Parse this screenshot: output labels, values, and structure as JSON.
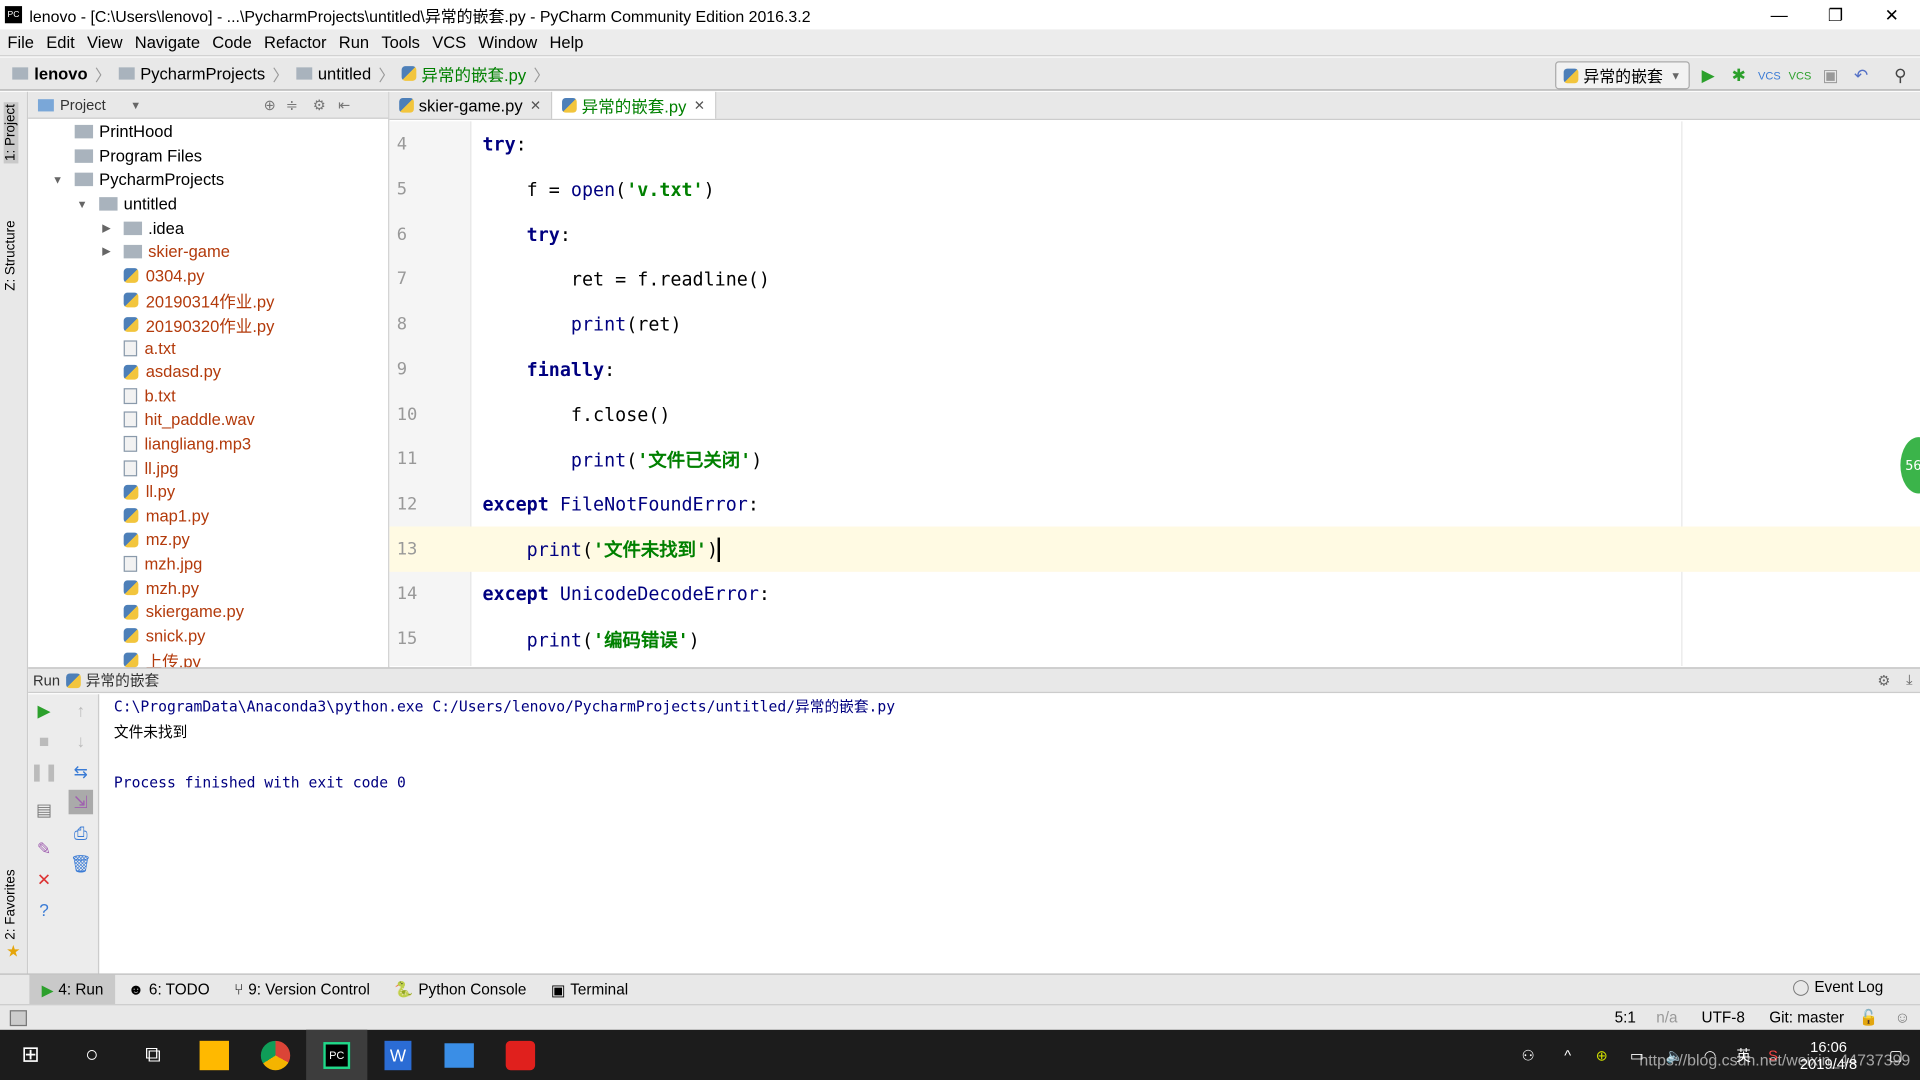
{
  "window": {
    "title": "lenovo - [C:\\Users\\lenovo] - ...\\PycharmProjects\\untitled\\异常的嵌套.py - PyCharm Community Edition 2016.3.2",
    "app_icon": "PC"
  },
  "menu": [
    "File",
    "Edit",
    "View",
    "Navigate",
    "Code",
    "Refactor",
    "Run",
    "Tools",
    "VCS",
    "Window",
    "Help"
  ],
  "breadcrumb": [
    "lenovo",
    "PycharmProjects",
    "untitled",
    "异常的嵌套.py"
  ],
  "run_config": "异常的嵌套",
  "toolbar_icons": [
    "run-icon",
    "debug-icon",
    "vcs-update-icon",
    "vcs-commit-icon",
    "history-icon",
    "revert-icon",
    "search-icon"
  ],
  "side_tabs": {
    "project": "1: Project",
    "structure": "Z: Structure",
    "favorites": "2: Favorites"
  },
  "project": {
    "header": "Project",
    "tree": [
      {
        "name": "PrintHood",
        "type": "folder",
        "depth": 1,
        "color": "#000"
      },
      {
        "name": "Program Files",
        "type": "folder",
        "depth": 1,
        "color": "#000"
      },
      {
        "name": "PycharmProjects",
        "type": "folder",
        "depth": 1,
        "expanded": true,
        "color": "#000"
      },
      {
        "name": "untitled",
        "type": "folder",
        "depth": 2,
        "expanded": true,
        "color": "#000"
      },
      {
        "name": ".idea",
        "type": "folder",
        "depth": 3,
        "collapsed": true,
        "color": "#000"
      },
      {
        "name": "skier-game",
        "type": "folder",
        "depth": 3,
        "collapsed": true,
        "color": "#b33a0b"
      },
      {
        "name": "0304.py",
        "type": "py",
        "depth": 3,
        "color": "#b33a0b"
      },
      {
        "name": "20190314作业.py",
        "type": "py",
        "depth": 3,
        "color": "#b33a0b"
      },
      {
        "name": "20190320作业.py",
        "type": "py",
        "depth": 3,
        "color": "#b33a0b"
      },
      {
        "name": "a.txt",
        "type": "txt",
        "depth": 3,
        "color": "#b33a0b"
      },
      {
        "name": "asdasd.py",
        "type": "py",
        "depth": 3,
        "color": "#b33a0b"
      },
      {
        "name": "b.txt",
        "type": "txt",
        "depth": 3,
        "color": "#b33a0b"
      },
      {
        "name": "hit_paddle.wav",
        "type": "file",
        "depth": 3,
        "color": "#b33a0b"
      },
      {
        "name": "liangliang.mp3",
        "type": "txt",
        "depth": 3,
        "color": "#b33a0b"
      },
      {
        "name": "ll.jpg",
        "type": "img",
        "depth": 3,
        "color": "#b33a0b"
      },
      {
        "name": "ll.py",
        "type": "py",
        "depth": 3,
        "color": "#b33a0b"
      },
      {
        "name": "map1.py",
        "type": "py",
        "depth": 3,
        "color": "#b33a0b"
      },
      {
        "name": "mz.py",
        "type": "py",
        "depth": 3,
        "color": "#b33a0b"
      },
      {
        "name": "mzh.jpg",
        "type": "img",
        "depth": 3,
        "color": "#b33a0b"
      },
      {
        "name": "mzh.py",
        "type": "py",
        "depth": 3,
        "color": "#b33a0b"
      },
      {
        "name": "skiergame.py",
        "type": "py",
        "depth": 3,
        "color": "#b33a0b"
      },
      {
        "name": "snick.py",
        "type": "py",
        "depth": 3,
        "color": "#b33a0b"
      },
      {
        "name": "上传.py",
        "type": "py",
        "depth": 3,
        "color": "#b33a0b"
      }
    ]
  },
  "tabs": [
    {
      "label": "skier-game.py",
      "active": false
    },
    {
      "label": "异常的嵌套.py",
      "active": true
    }
  ],
  "editor": {
    "current_line": 13,
    "lines": [
      {
        "n": "4",
        "tokens": [
          {
            "t": "try",
            "c": "kw"
          },
          {
            "t": ":",
            "c": "tx"
          }
        ]
      },
      {
        "n": "5",
        "tokens": [
          {
            "t": "    f = ",
            "c": "tx"
          },
          {
            "t": "open",
            "c": "bi"
          },
          {
            "t": "(",
            "c": "tx"
          },
          {
            "t": "'v.txt'",
            "c": "st"
          },
          {
            "t": ")",
            "c": "tx"
          }
        ]
      },
      {
        "n": "6",
        "tokens": [
          {
            "t": "    ",
            "c": "tx"
          },
          {
            "t": "try",
            "c": "kw"
          },
          {
            "t": ":",
            "c": "tx"
          }
        ]
      },
      {
        "n": "7",
        "tokens": [
          {
            "t": "        ret = f.readline()",
            "c": "tx"
          }
        ]
      },
      {
        "n": "8",
        "tokens": [
          {
            "t": "        ",
            "c": "tx"
          },
          {
            "t": "print",
            "c": "bi"
          },
          {
            "t": "(ret)",
            "c": "tx"
          }
        ]
      },
      {
        "n": "9",
        "tokens": [
          {
            "t": "    ",
            "c": "tx"
          },
          {
            "t": "finally",
            "c": "kw"
          },
          {
            "t": ":",
            "c": "tx"
          }
        ]
      },
      {
        "n": "10",
        "tokens": [
          {
            "t": "        f.close()",
            "c": "tx"
          }
        ]
      },
      {
        "n": "11",
        "tokens": [
          {
            "t": "        ",
            "c": "tx"
          },
          {
            "t": "print",
            "c": "bi"
          },
          {
            "t": "(",
            "c": "tx"
          },
          {
            "t": "'文件已关闭'",
            "c": "st"
          },
          {
            "t": ")",
            "c": "tx"
          }
        ]
      },
      {
        "n": "12",
        "tokens": [
          {
            "t": "except ",
            "c": "kw"
          },
          {
            "t": "FileNotFoundError",
            "c": "bi"
          },
          {
            "t": ":",
            "c": "tx"
          }
        ]
      },
      {
        "n": "13",
        "tokens": [
          {
            "t": "    ",
            "c": "tx"
          },
          {
            "t": "print",
            "c": "bi"
          },
          {
            "t": "(",
            "c": "tx"
          },
          {
            "t": "'文件未找到'",
            "c": "st"
          },
          {
            "t": ")",
            "c": "tx"
          }
        ]
      },
      {
        "n": "14",
        "tokens": [
          {
            "t": "except ",
            "c": "kw"
          },
          {
            "t": "UnicodeDecodeError",
            "c": "bi"
          },
          {
            "t": ":",
            "c": "tx"
          }
        ]
      },
      {
        "n": "15",
        "tokens": [
          {
            "t": "    ",
            "c": "tx"
          },
          {
            "t": "print",
            "c": "bi"
          },
          {
            "t": "(",
            "c": "tx"
          },
          {
            "t": "'编码错误'",
            "c": "st"
          },
          {
            "t": ")",
            "c": "tx"
          }
        ]
      }
    ]
  },
  "run": {
    "label": "Run",
    "config": "异常的嵌套",
    "output": [
      {
        "text": "C:\\ProgramData\\Anaconda3\\python.exe C:/Users/lenovo/PycharmProjects/untitled/异常的嵌套.py",
        "color": "#000080"
      },
      {
        "text": "文件未找到",
        "color": "#000"
      },
      {
        "text": "",
        "color": "#000"
      },
      {
        "text": "Process finished with exit code 0",
        "color": "#000080"
      }
    ]
  },
  "bottom_tabs": [
    {
      "label": "4: Run",
      "active": true
    },
    {
      "label": "6: TODO"
    },
    {
      "label": "9: Version Control"
    },
    {
      "label": "Python Console"
    },
    {
      "label": "Terminal"
    }
  ],
  "event_log": "Event Log",
  "status": {
    "position": "5:1",
    "na": "n/a",
    "encoding": "UTF-8",
    "git": "Git: master"
  },
  "taskbar": {
    "time": "16:06",
    "date": "2019/4/8",
    "ime": "英",
    "watermark": "https://blog.csdn.net/weixin_44737399"
  }
}
